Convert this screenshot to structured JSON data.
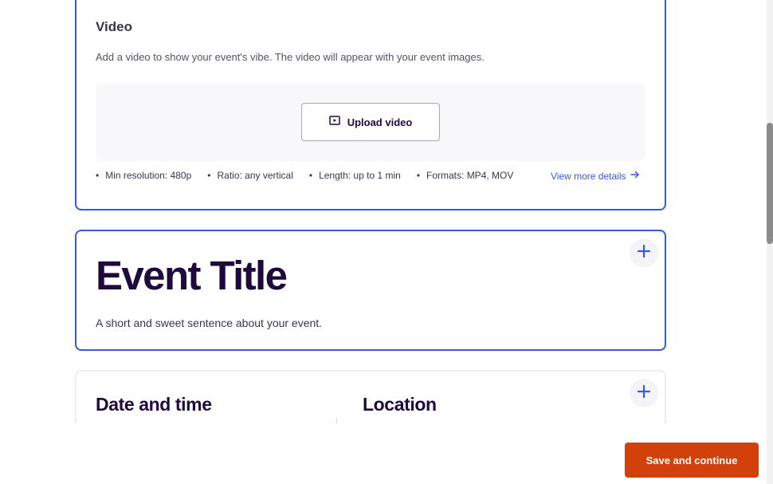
{
  "video": {
    "heading": "Video",
    "description": "Add a video to show your event's vibe. The video will appear with your event images.",
    "upload_label": "Upload video",
    "upload_icon": "video-upload-icon",
    "requirements": [
      "Min resolution: 480p",
      "Ratio: any vertical",
      "Length: up to 1 min",
      "Formats: MP4, MOV"
    ],
    "more_link": "View more details",
    "more_icon": "arrow-right-icon"
  },
  "title_card": {
    "title": "Event Title",
    "summary": "A short and sweet sentence about your event.",
    "add_icon": "plus-icon"
  },
  "details_card": {
    "date_heading": "Date and time",
    "location_heading": "Location",
    "add_icon": "plus-icon"
  },
  "footer": {
    "save_label": "Save and continue"
  },
  "colors": {
    "accent": "#3659e3",
    "primary_action": "#d1410c",
    "text_dark": "#1e0a3c"
  }
}
